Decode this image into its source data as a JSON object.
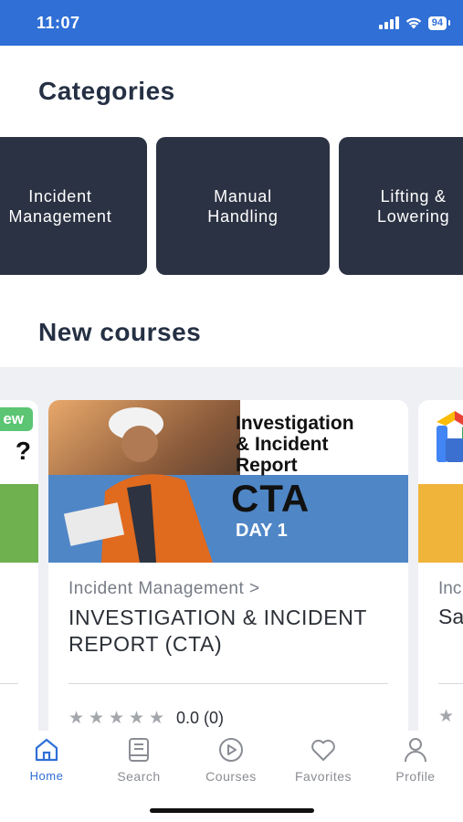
{
  "status_bar": {
    "time": "11:07",
    "battery": "94",
    "icons": [
      "signal-icon",
      "wifi-icon",
      "battery-icon"
    ]
  },
  "categories_section": {
    "title": "Categories",
    "items": [
      {
        "label": "Incident\nManagement"
      },
      {
        "label": "Manual\nHandling"
      },
      {
        "label": "Lifting &\nLowering"
      }
    ]
  },
  "new_courses_section": {
    "title": "New courses",
    "left_partial_card": {
      "badge": "ew",
      "title_fragment": "?"
    },
    "featured_course": {
      "thumbnail": {
        "heading_line1": "Investigation",
        "heading_line2": "& Incident",
        "heading_line3": "Report",
        "code": "CTA",
        "day": "DAY 1"
      },
      "category": "Incident Management >",
      "title": "INVESTIGATION & INCIDENT REPORT (CTA)",
      "stars": 5,
      "rating": "0.0 (0)"
    },
    "right_partial_card": {
      "category_fragment": "Inc",
      "title_fragment": "Sa"
    }
  },
  "bottom_nav": {
    "items": [
      {
        "label": "Home",
        "icon": "home-icon",
        "active": true
      },
      {
        "label": "Search",
        "icon": "book-icon",
        "active": false
      },
      {
        "label": "Courses",
        "icon": "play-icon",
        "active": false
      },
      {
        "label": "Favorites",
        "icon": "heart-icon",
        "active": false
      },
      {
        "label": "Profile",
        "icon": "user-icon",
        "active": false
      }
    ]
  },
  "colors": {
    "accent": "#2f6fd6",
    "category_card": "#2b3243",
    "strip_bg": "#eef0f4"
  }
}
